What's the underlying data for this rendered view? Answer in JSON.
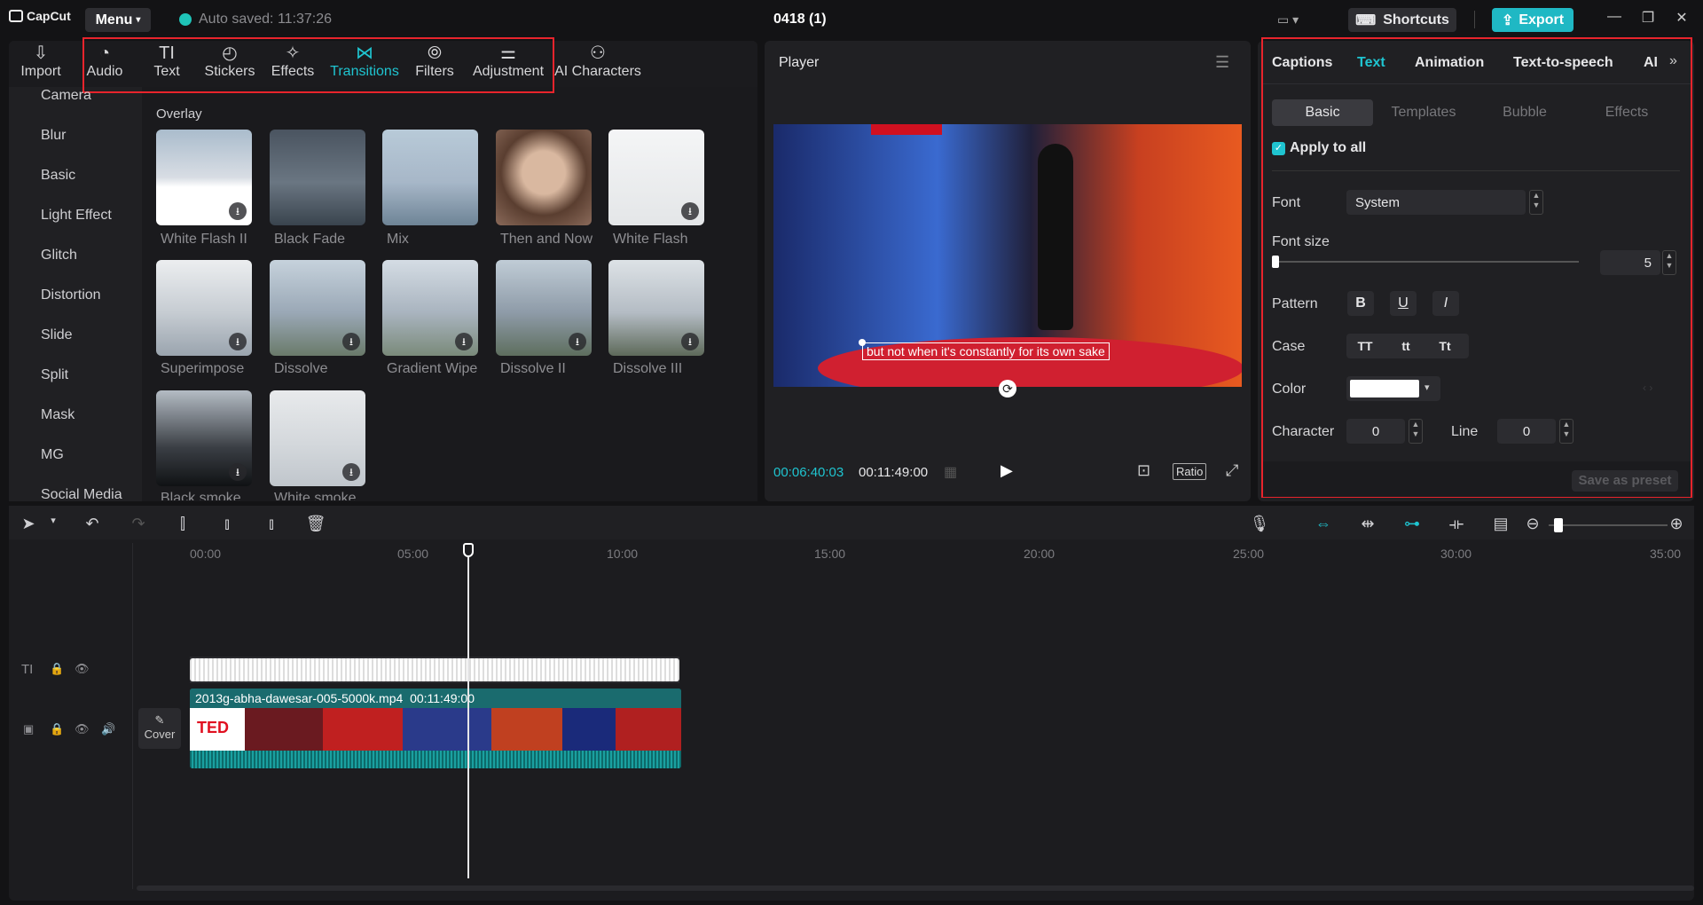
{
  "app": {
    "name": "CapCut",
    "menu_label": "Menu",
    "autosave": "Auto saved: 11:37:26",
    "project_title": "0418 (1)",
    "shortcuts_label": "Shortcuts",
    "export_label": "Export"
  },
  "toolbar": {
    "import": "Import",
    "audio": "Audio",
    "text": "Text",
    "stickers": "Stickers",
    "effects": "Effects",
    "transitions": "Transitions",
    "filters": "Filters",
    "adjustment": "Adjustment",
    "ai_characters": "AI Characters"
  },
  "sidebar": [
    "Camera",
    "Blur",
    "Basic",
    "Light Effect",
    "Glitch",
    "Distortion",
    "Slide",
    "Split",
    "Mask",
    "MG",
    "Social Media"
  ],
  "overlay": {
    "section": "Overlay",
    "items": [
      {
        "label": "White Flash II",
        "color": "#d8dde4"
      },
      {
        "label": "Black Fade",
        "color": "#5a6470"
      },
      {
        "label": "Mix",
        "color": "#a7b7c8"
      },
      {
        "label": "Then and Now",
        "color": "#8a6a5a"
      },
      {
        "label": "White Flash",
        "color": "#eceef0"
      },
      {
        "label": "Superimpose",
        "color": "#c6ccd2"
      },
      {
        "label": "Dissolve",
        "color": "#9aa8b6"
      },
      {
        "label": "Gradient Wipe",
        "color": "#a9b4bf"
      },
      {
        "label": "Dissolve II",
        "color": "#8e9ba8"
      },
      {
        "label": "Dissolve III",
        "color": "#b4bcc4"
      },
      {
        "label": "Black smoke",
        "color": "#3a3e44"
      },
      {
        "label": "White smoke",
        "color": "#d4d8dc"
      }
    ]
  },
  "player": {
    "label": "Player",
    "caption": "but not when it's constantly for its own sake",
    "current_time": "00:06:40:03",
    "duration": "00:11:49:00",
    "ratio_label": "Ratio"
  },
  "right_panel": {
    "tabs": [
      "Captions",
      "Text",
      "Animation",
      "Text-to-speech",
      "AI"
    ],
    "subtabs": [
      "Basic",
      "Templates",
      "Bubble",
      "Effects"
    ],
    "apply_all": "Apply to all",
    "font_label": "Font",
    "font_value": "System",
    "font_size_label": "Font size",
    "font_size_value": "5",
    "pattern_label": "Pattern",
    "pattern_buttons": [
      "B",
      "U",
      "I"
    ],
    "case_label": "Case",
    "case_buttons": [
      "TT",
      "tt",
      "Tt"
    ],
    "color_label": "Color",
    "color_value": "#ffffff",
    "character_label": "Character",
    "character_value": "0",
    "line_label": "Line",
    "line_value": "0",
    "save_preset": "Save as preset"
  },
  "timeline": {
    "ruler": [
      "00:00",
      "05:00",
      "10:00",
      "15:00",
      "20:00",
      "25:00",
      "30:00",
      "35:00"
    ],
    "clip_name": "2013g-abha-dawesar-005-5000k.mp4",
    "clip_duration": "00:11:49:00",
    "cover_label": "Cover",
    "clip_logo": "TED"
  }
}
